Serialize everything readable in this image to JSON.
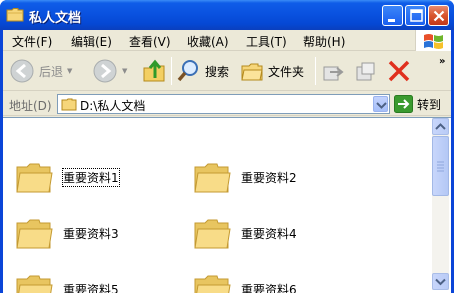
{
  "window": {
    "title": "私人文档"
  },
  "menu": {
    "items": [
      {
        "label": "文件(F)"
      },
      {
        "label": "编辑(E)"
      },
      {
        "label": "查看(V)"
      },
      {
        "label": "收藏(A)"
      },
      {
        "label": "工具(T)"
      },
      {
        "label": "帮助(H)"
      }
    ]
  },
  "toolbar": {
    "back_label": "后退",
    "search_label": "搜索",
    "folders_label": "文件夹",
    "overflow": "»"
  },
  "address": {
    "label": "地址(D)",
    "value": "D:\\私人文档",
    "go_label": "转到"
  },
  "files": [
    {
      "name": "重要资料1"
    },
    {
      "name": "重要资料2"
    },
    {
      "name": "重要资料3"
    },
    {
      "name": "重要资料4"
    },
    {
      "name": "重要资料5"
    },
    {
      "name": "重要资料6"
    }
  ],
  "colors": {
    "titlebar": "#0a52e0",
    "frame": "#ece9d8",
    "close_button": "#d8552d",
    "folder": "#f5d77a"
  }
}
